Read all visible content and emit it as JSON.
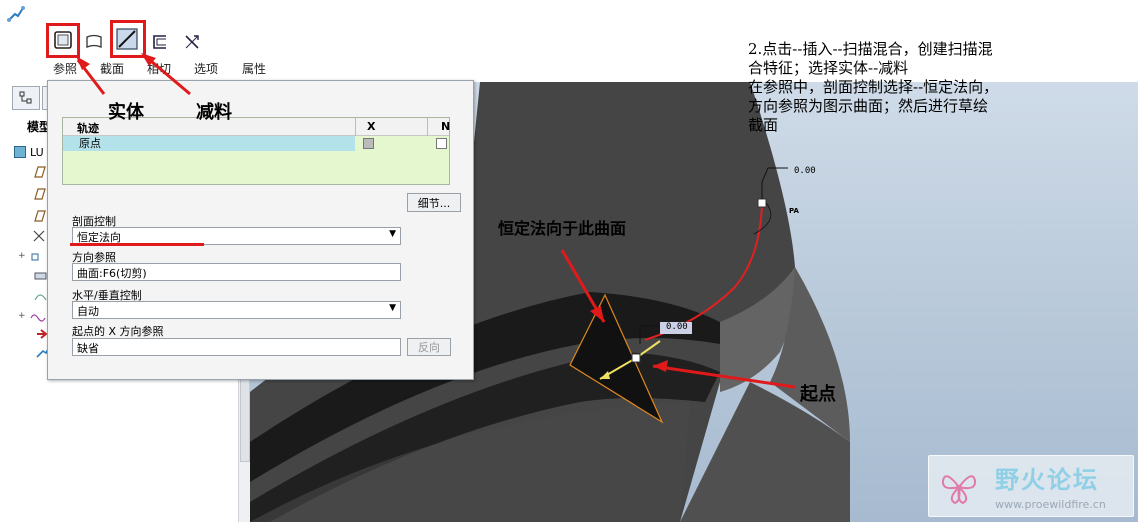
{
  "toolbar": {
    "tabs": [
      "参照",
      "截面",
      "相切",
      "选项",
      "属性"
    ]
  },
  "annotations": {
    "solid_label": "实体",
    "cut_label": "减料",
    "normal_label": "恒定法向于此曲面",
    "start_label": "起点",
    "instructions": [
      "2.点击--插入--扫描混合，创建扫描混",
      "合特征；选择实体--减料",
      "在参照中，剖面控制选择--恒定法向，",
      "方向参照为图示曲面；然后进行草绘",
      "截面"
    ]
  },
  "model_tree": {
    "title": "模型",
    "root": "LU"
  },
  "panel": {
    "trajectory": {
      "col_name": "轨迹",
      "col_x": "X",
      "col_n": "N",
      "rows": [
        {
          "name": "原点"
        }
      ]
    },
    "detail_button": "细节...",
    "section_control": {
      "label": "剖面控制",
      "value": "恒定法向"
    },
    "direction_ref": {
      "label": "方向参照",
      "value": "曲面:F6(切剪)"
    },
    "hv_control": {
      "label": "水平/垂直控制",
      "value": "自动"
    },
    "x_dir_ref": {
      "label": "起点的 X 方向参照",
      "value": "缺省"
    },
    "flip_button": "反向"
  },
  "viewport": {
    "dim_top": "0.00",
    "dim_mid": "0.00",
    "point_label": "PA"
  },
  "watermark": {
    "name": "野火论坛",
    "url": "www.proewildfire.cn"
  },
  "colors": {
    "highlight_red": "#e01a1a",
    "list_select": "#b4e2ea",
    "list_bg": "#e5f7cf"
  }
}
